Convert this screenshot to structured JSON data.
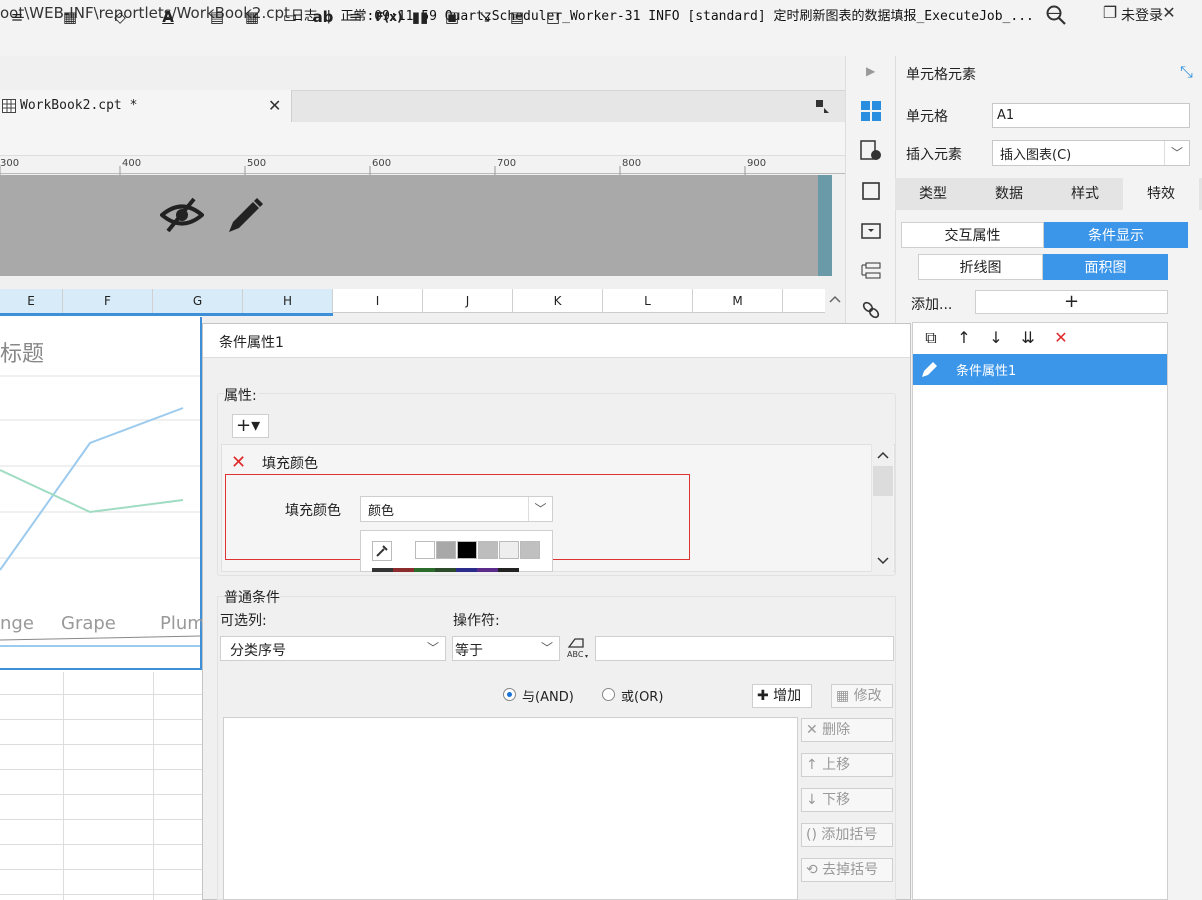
{
  "window": {
    "title": "oot\\WEB-INF\\reportlets/WorkBook2.cpt",
    "minimize_glyph": "—",
    "maximize_glyph": "❐",
    "close_glyph": "✕"
  },
  "logbar": {
    "text": "日志 | 正常:09:11:59 QuartzScheduler_Worker-31 INFO [standard] 定时刷新图表的数据填报_ExecuteJob_...",
    "search_icon": "search-icon",
    "login": "未登录"
  },
  "document": {
    "tab_label": "WorkBook2.cpt *",
    "tab_close": "✕"
  },
  "toolbar": {
    "items": [
      "≡",
      "▦",
      "◇",
      "A",
      "▤",
      "▦",
      "▭",
      "ab",
      "≡",
      "F(x)",
      "▮▮",
      "▣",
      "↘",
      "▤",
      "□"
    ]
  },
  "ruler": {
    "labels": [
      "300",
      "400",
      "500",
      "600",
      "700",
      "800",
      "900"
    ]
  },
  "columns": [
    "E",
    "F",
    "G",
    "H",
    "I",
    "J",
    "K",
    "L",
    "M"
  ],
  "chart": {
    "title": "标题",
    "x_labels": [
      "nge",
      "Grape",
      "Plum"
    ]
  },
  "right_panel": {
    "title": "单元格元素",
    "cell_label": "单元格",
    "cell_value": "A1",
    "insert_label": "插入元素",
    "insert_value": "插入图表(C)",
    "tabs": [
      "类型",
      "数据",
      "样式",
      "特效"
    ],
    "subtabs": [
      "交互属性",
      "条件显示"
    ],
    "chart_tabs": [
      "折线图",
      "面积图"
    ],
    "add_label": "添加...",
    "add_button": "+",
    "list_items": [
      "条件属性1"
    ]
  },
  "dialog": {
    "title": "条件属性1",
    "attr_group_label": "属性:",
    "plus_menu": "+▾",
    "fill_header": "填充颜色",
    "fill_label": "填充颜色",
    "color_value": "颜色",
    "normal_group_label": "普通条件",
    "column_label": "可选列:",
    "operator_label": "操作符:",
    "column_value": "分类序号",
    "operator_value": "等于",
    "and_label": "与(AND)",
    "or_label": "或(OR)",
    "buttons": {
      "add": "✚ 增加",
      "modify": "▦ 修改",
      "delete": "✕ 删除",
      "move_up": "↑ 上移",
      "move_down": "↓ 下移",
      "add_bracket": "() 添加括号",
      "remove_bracket": "⟲ 去掉括号"
    }
  },
  "colors": {
    "accent": "#3b95e8",
    "selection": "#d7ecf8",
    "danger": "#e02b2b"
  }
}
